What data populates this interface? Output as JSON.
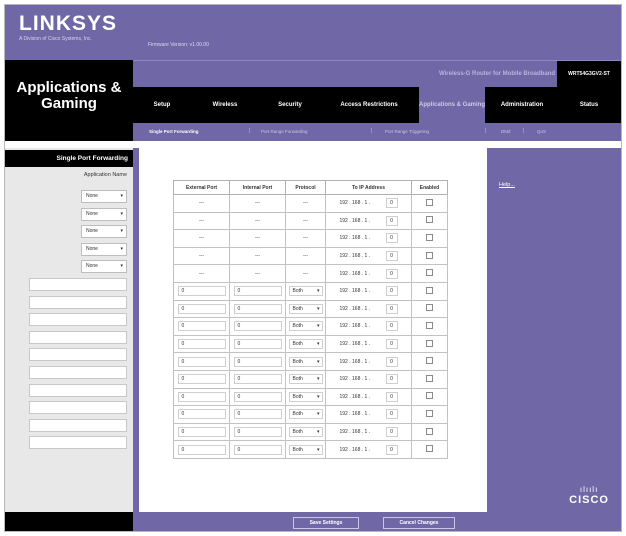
{
  "header": {
    "logo": "LINKSYS",
    "logo_sub": "A Division of Cisco Systems, Inc.",
    "firmware": "Firmware Version: v1.00.00",
    "product_name": "Wireless-G Router for Mobile Broadband",
    "model": "WRT54G3GV2-ST",
    "page_title_line1": "Applications &",
    "page_title_line2": "Gaming"
  },
  "tabs": [
    {
      "label": "Setup"
    },
    {
      "label": "Wireless"
    },
    {
      "label": "Security"
    },
    {
      "label": "Access Restrictions"
    },
    {
      "label": "Applications & Gaming"
    },
    {
      "label": "Administration"
    },
    {
      "label": "Status"
    }
  ],
  "subtabs": [
    {
      "label": "Single Port Forwarding"
    },
    {
      "label": "Port Range Forwarding"
    },
    {
      "label": "Port Range Triggering"
    },
    {
      "label": "DMZ"
    },
    {
      "label": "QoS"
    }
  ],
  "sidebar": {
    "section_title": "Single Port Forwarding",
    "app_name_label": "Application Name",
    "preset_apps": [
      "None",
      "None",
      "None",
      "None",
      "None"
    ]
  },
  "table": {
    "headers": [
      "External Port",
      "Internal Port",
      "Protocol",
      "To IP Address",
      "Enabled"
    ],
    "ip_prefix": "192 . 168 . 1 .",
    "preset_rows": [
      {
        "ext": "---",
        "int": "---",
        "proto": "---",
        "ip_last": "0"
      },
      {
        "ext": "---",
        "int": "---",
        "proto": "---",
        "ip_last": "0"
      },
      {
        "ext": "---",
        "int": "---",
        "proto": "---",
        "ip_last": "0"
      },
      {
        "ext": "---",
        "int": "---",
        "proto": "---",
        "ip_last": "0"
      },
      {
        "ext": "---",
        "int": "---",
        "proto": "---",
        "ip_last": "0"
      }
    ],
    "custom_rows": [
      {
        "ext": "0",
        "int": "0",
        "proto": "Both",
        "ip_last": "0"
      },
      {
        "ext": "0",
        "int": "0",
        "proto": "Both",
        "ip_last": "0"
      },
      {
        "ext": "0",
        "int": "0",
        "proto": "Both",
        "ip_last": "0"
      },
      {
        "ext": "0",
        "int": "0",
        "proto": "Both",
        "ip_last": "0"
      },
      {
        "ext": "0",
        "int": "0",
        "proto": "Both",
        "ip_last": "0"
      },
      {
        "ext": "0",
        "int": "0",
        "proto": "Both",
        "ip_last": "0"
      },
      {
        "ext": "0",
        "int": "0",
        "proto": "Both",
        "ip_last": "0"
      },
      {
        "ext": "0",
        "int": "0",
        "proto": "Both",
        "ip_last": "0"
      },
      {
        "ext": "0",
        "int": "0",
        "proto": "Both",
        "ip_last": "0"
      },
      {
        "ext": "0",
        "int": "0",
        "proto": "Both",
        "ip_last": "0"
      }
    ]
  },
  "help": {
    "link": "Help..."
  },
  "brand": {
    "bars": "ılıılı",
    "word": "CISCO"
  },
  "footer": {
    "save": "Save Settings",
    "cancel": "Cancel Changes"
  },
  "colors": {
    "purple": "#6f67a6",
    "black": "#000000",
    "sidebar_gray": "#e8e8e8"
  }
}
